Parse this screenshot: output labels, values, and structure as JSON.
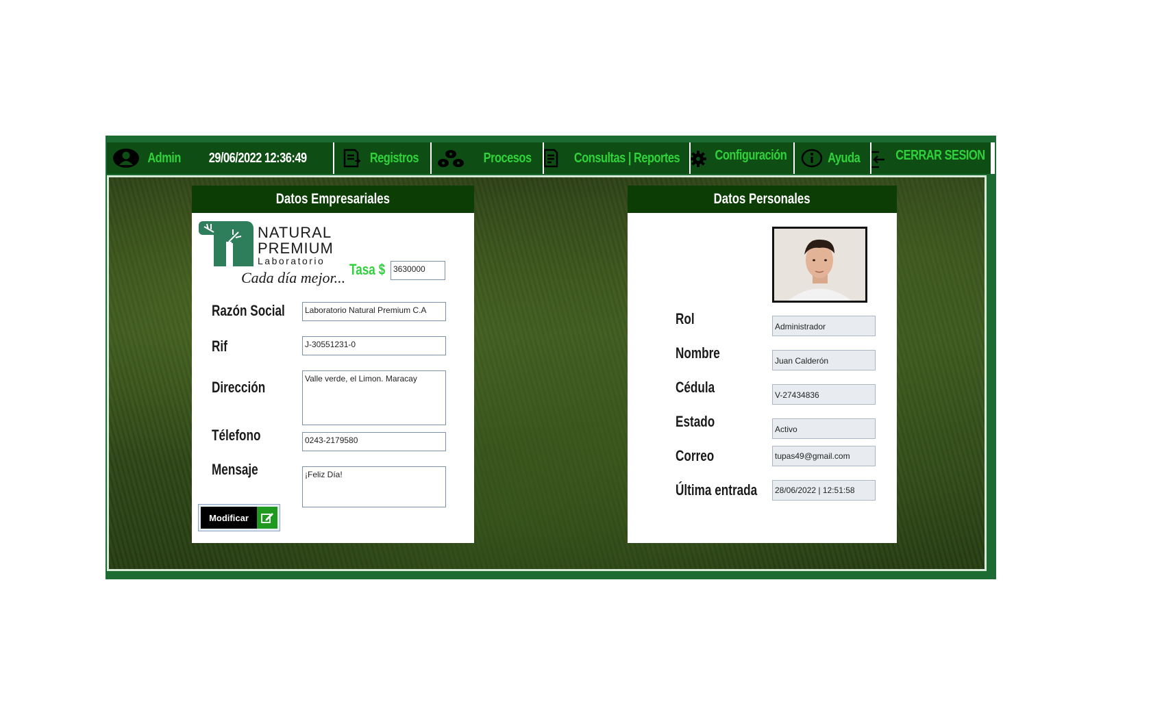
{
  "menu": {
    "user": "Admin",
    "datetime": "29/06/2022  12:36:49",
    "registros": "Registros",
    "procesos": "Procesos",
    "consultas": "Consultas | Reportes",
    "configuracion": "Configuración",
    "ayuda": "Ayuda",
    "cerrar": "CERRAR SESION"
  },
  "empresa": {
    "header": "Datos Empresariales",
    "logo_line1": "NATURAL",
    "logo_line2": "PREMIUM",
    "logo_line3": "Laboratorio",
    "slogan": "Cada día mejor...",
    "tasa_label": "Tasa $",
    "tasa_value": "3630000",
    "razon_label": "Razón Social",
    "razon_value": "Laboratorio Natural Premium C.A",
    "rif_label": "Rif",
    "rif_value": "J-30551231-0",
    "direccion_label": "Dirección",
    "direccion_value": "Valle verde, el Limon. Maracay",
    "telefono_label": "Télefono",
    "telefono_value": "0243-2179580",
    "mensaje_label": "Mensaje",
    "mensaje_value": "¡Feliz Día!",
    "modificar": "Modificar"
  },
  "personal": {
    "header": "Datos Personales",
    "rol_label": "Rol",
    "rol_value": "Administrador",
    "nombre_label": "Nombre",
    "nombre_value": "Juan Calderón",
    "cedula_label": "Cédula",
    "cedula_value": "V-27434836",
    "estado_label": "Estado",
    "estado_value": "Activo",
    "correo_label": "Correo",
    "correo_value": "tupas49@gmail.com",
    "ultima_label": "Última entrada",
    "ultima_value": "28/06/2022 | 12:51:58"
  },
  "colors": {
    "menu_bg": "#0e4d14",
    "menu_text": "#2fd23b",
    "header_bg": "#0b3d05",
    "frame": "#1c6b33"
  }
}
